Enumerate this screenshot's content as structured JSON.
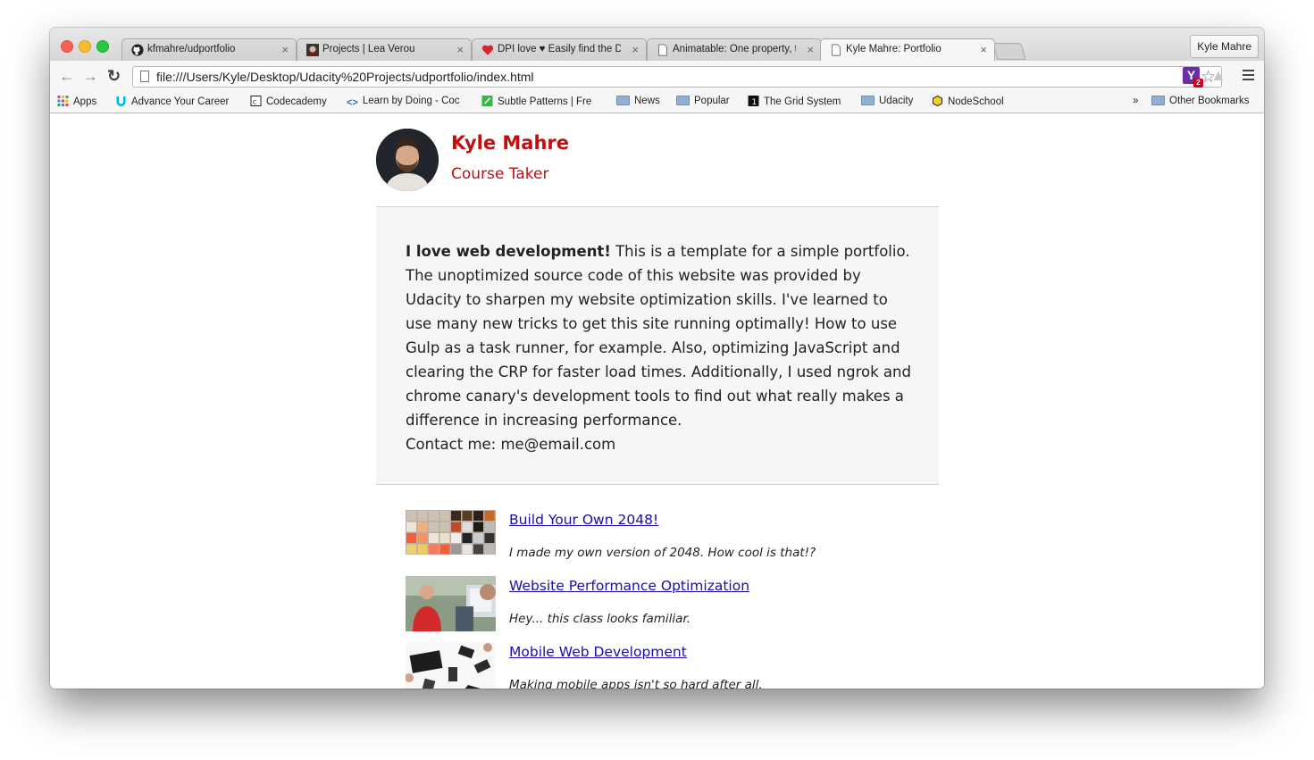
{
  "browser": {
    "tabs": [
      {
        "title": "kfmahre/udportfolio",
        "icon": "github-icon",
        "active": false
      },
      {
        "title": "Projects | Lea Verou",
        "icon": "lea-verou-avatar-icon",
        "active": false
      },
      {
        "title": "DPI love ♥ Easily find the D",
        "icon": "heart-icon",
        "active": false
      },
      {
        "title": "Animatable: One property, t",
        "icon": "page-icon",
        "active": false
      },
      {
        "title": "Kyle Mahre: Portfolio",
        "icon": "page-icon",
        "active": true
      }
    ],
    "close_glyph": "×",
    "profile_name": "Kyle Mahre",
    "url": "file:///Users/Kyle/Desktop/Udacity%20Projects/udportfolio/index.html",
    "extension_badge": "2",
    "extension_letter": "Y"
  },
  "bookmarks": {
    "items": [
      {
        "label": "Apps",
        "icon": "apps-grid-icon"
      },
      {
        "label": "Advance Your Career",
        "icon": "udacity-icon"
      },
      {
        "label": "Codecademy",
        "icon": "codecademy-icon"
      },
      {
        "label": "Learn by Doing - Coc",
        "icon": "code-brackets-icon"
      },
      {
        "label": "Subtle Patterns | Fre",
        "icon": "subtle-patterns-icon"
      },
      {
        "label": "News",
        "icon": "folder-icon"
      },
      {
        "label": "Popular",
        "icon": "folder-icon"
      },
      {
        "label": "The Grid System",
        "icon": "grid-system-icon"
      },
      {
        "label": "Udacity",
        "icon": "folder-icon"
      },
      {
        "label": "NodeSchool",
        "icon": "nodeschool-hexagon-icon"
      }
    ],
    "overflow": "»",
    "other": "Other Bookmarks"
  },
  "page": {
    "name": "Kyle Mahre",
    "role": "Course Taker",
    "about_bold": "I love web development!",
    "about_text": " This is a template for a simple portfolio. The unoptimized source code of this website was provided by Udacity to sharpen my website optimization skills. I've learned to use many new tricks to get this site running optimally! How to use Gulp as a task runner, for example. Also, optimizing JavaScript and clearing the CRP for faster load times. Additionally, I used ngrok and chrome canary's development tools to find out what really makes a difference in increasing performance.",
    "contact": "Contact me: me@email.com",
    "projects": [
      {
        "title": "Build Your Own 2048!",
        "description": "I made my own version of 2048. How cool is that!?",
        "thumb": "2048-thumbnail"
      },
      {
        "title": "Website Performance Optimization",
        "description": "Hey... this class looks familiar.",
        "thumb": "webperf-thumbnail"
      },
      {
        "title": "Mobile Web Development",
        "description": "Making mobile apps isn't so hard after all.",
        "thumb": "mobile-devices-thumbnail"
      }
    ]
  },
  "colors": {
    "accent": "#c10f0f",
    "link": "#1a0dab",
    "about_bg": "#f6f6f6"
  }
}
